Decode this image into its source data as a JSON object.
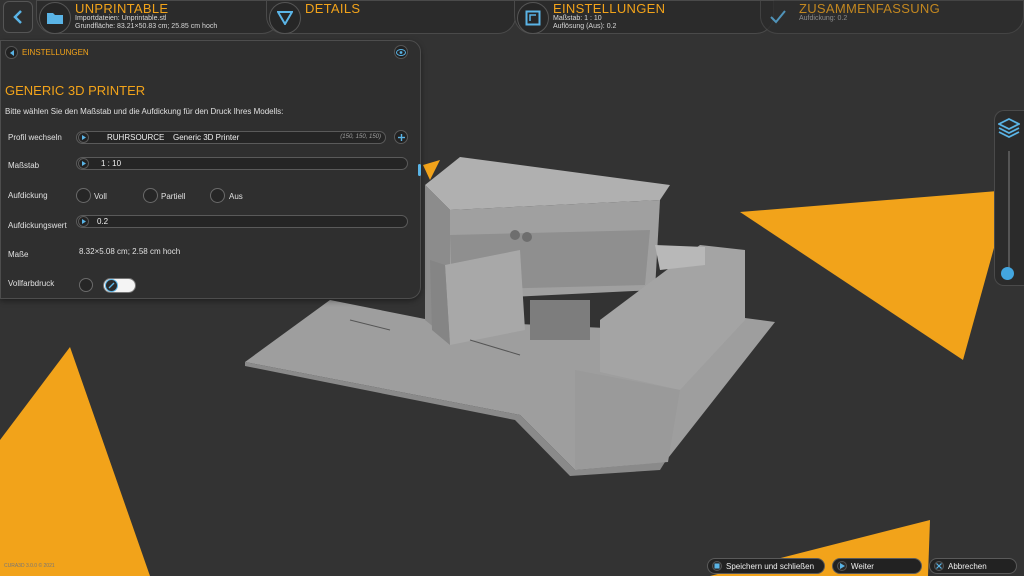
{
  "steps": [
    {
      "title": "UNPRINTABLE",
      "line1": "Importdateien: Unprintable.stl",
      "line2": "Grundfläche: 83.21×50.83 cm; 25.85 cm hoch",
      "icon": "folder-icon"
    },
    {
      "title": "DETAILS",
      "icon": "triangle-down-icon"
    },
    {
      "title": "EINSTELLUNGEN",
      "line1": "Maßstab: 1 : 10",
      "line2": "Auflösung (Aus): 0.2",
      "icon": "resize-icon"
    },
    {
      "title": "ZUSAMMENFASSUNG",
      "line1": "Aufdickung: 0.2",
      "icon": "check-icon"
    }
  ],
  "panel": {
    "crumb": "EINSTELLUNGEN",
    "title": "GENERIC 3D PRINTER",
    "description": "Bitte wählen Sie den Maßstab und die Aufdickung für den Druck Ihres Modells:",
    "profile": {
      "label": "Profil wechseln",
      "brand": "RUHRSOURCE",
      "name": "Generic 3D Printer",
      "dims": "(150, 150, 150)"
    },
    "scale": {
      "label": "Maßstab",
      "value": "1 : 10"
    },
    "thickening": {
      "label": "Aufdickung",
      "options": [
        "Voll",
        "Partiell",
        "Aus"
      ]
    },
    "thickening_value": {
      "label": "Aufdickungswert",
      "value": "0.2"
    },
    "dimensions": {
      "label": "Maße",
      "value": "8.32×5.08 cm; 2.58 cm  hoch"
    },
    "fullcolor": {
      "label": "Vollfarbdruck"
    }
  },
  "footer": {
    "version": "CURA3D 3.0.0 © 2021",
    "save": "Speichern und schließen",
    "next": "Weiter",
    "cancel": "Abbrechen"
  },
  "colors": {
    "accent": "#f2a31a",
    "blue": "#5ab4e6",
    "background": "#333333"
  }
}
